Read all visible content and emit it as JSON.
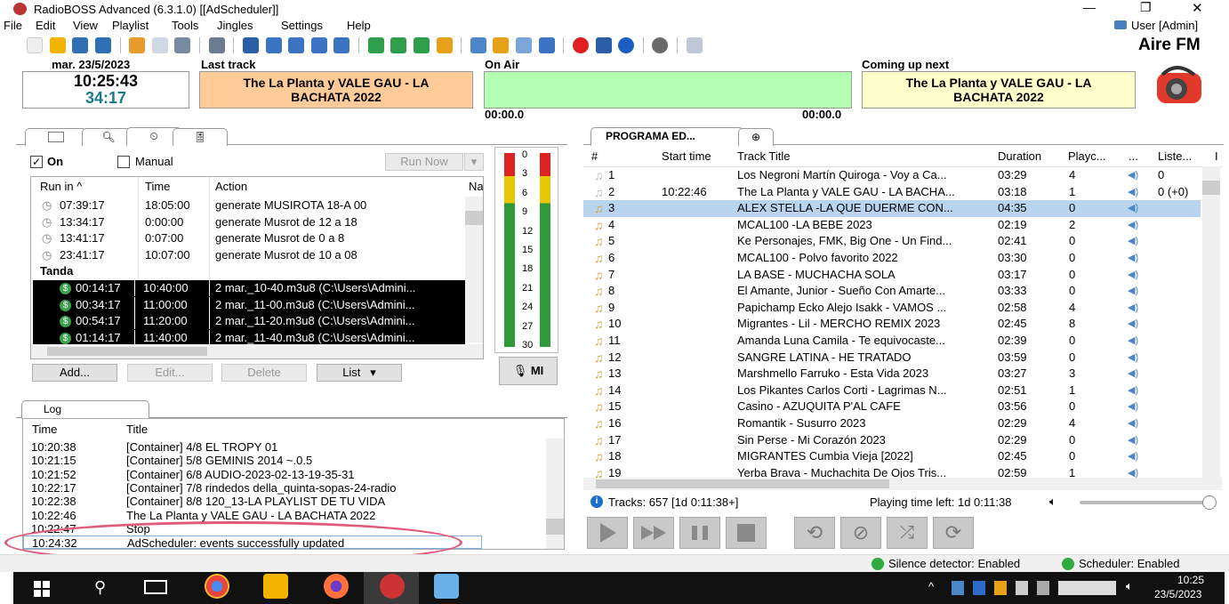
{
  "window": {
    "title": "RadioBOSS Advanced (6.3.1.0) [[AdScheduler]]",
    "user": "User [Admin]",
    "station": "Aire FM"
  },
  "menu": [
    "File",
    "Edit",
    "View",
    "Playlist",
    "Tools",
    "Jingles",
    "Settings",
    "Help"
  ],
  "info": {
    "date": "mar. 23/5/2023",
    "time": "10:25:43",
    "elapsed": "34:17",
    "last_track_label": "Last track",
    "last_track": "The La Planta y VALE GAU - LA BACHATA 2022",
    "on_air_label": "On Air",
    "on_air_start": "00:00.0",
    "on_air_end": "00:00.0",
    "next_label": "Coming up next",
    "next_track": "The La Planta y VALE GAU - LA BACHATA 2022"
  },
  "scheduler": {
    "on_label": "On",
    "manual_label": "Manual",
    "run_now": "Run Now",
    "columns": [
      "Run in",
      "Time",
      "Action",
      "Na"
    ],
    "rows": [
      {
        "runin": "07:39:17",
        "time": "18:05:00",
        "action": "generate MUSIROTA 18-A 00"
      },
      {
        "runin": "13:34:17",
        "time": "0:00:00",
        "action": "generate Musrot de 12 a 18"
      },
      {
        "runin": "13:41:17",
        "time": "0:07:00",
        "action": "generate Musrot de 0 a 8"
      },
      {
        "runin": "23:41:17",
        "time": "10:07:00",
        "action": "generate Musrot de 10 a 08"
      }
    ],
    "group": "Tanda",
    "tanda_rows": [
      {
        "runin": "00:14:17",
        "time": "10:40:00",
        "action": "2 mar._10-40.m3u8 (C:\\Users\\Admini..."
      },
      {
        "runin": "00:34:17",
        "time": "11:00:00",
        "action": "2 mar._11-00.m3u8 (C:\\Users\\Admini..."
      },
      {
        "runin": "00:54:17",
        "time": "11:20:00",
        "action": "2 mar._11-20.m3u8 (C:\\Users\\Admini..."
      },
      {
        "runin": "01:14:17",
        "time": "11:40:00",
        "action": "2 mar._11-40.m3u8 (C:\\Users\\Admini..."
      }
    ],
    "buttons": {
      "add": "Add...",
      "edit": "Edit...",
      "delete": "Delete",
      "list": "List"
    }
  },
  "meter": {
    "ticks": [
      "0",
      "3",
      "6",
      "9",
      "12",
      "15",
      "18",
      "21",
      "24",
      "27",
      "30"
    ],
    "mic_label": "MI"
  },
  "log": {
    "tab": "Log",
    "columns": [
      "Time",
      "Title"
    ],
    "rows": [
      {
        "time": "10:20:38",
        "title": "[Container] 4/8 EL TROPY 01"
      },
      {
        "time": "10:21:15",
        "title": "[Container] 5/8 GEMINIS 2014  ~.0.5"
      },
      {
        "time": "10:21:52",
        "title": "[Container] 6/8 AUDIO-2023-02-13-19-35-31"
      },
      {
        "time": "10:22:17",
        "title": "[Container] 7/8 rindedos  della_quinta-sopas-24-radio"
      },
      {
        "time": "10:22:38",
        "title": "[Container] 8/8 120_13-LA PLAYLIST DE TU VIDA"
      },
      {
        "time": "10:22:46",
        "title": "The La Planta y VALE GAU - LA BACHATA 2022"
      },
      {
        "time": "10:22:47",
        "title": "Stop"
      },
      {
        "time": "10:24:32",
        "title": "AdScheduler: events successfully updated"
      }
    ]
  },
  "playlist": {
    "tab": "PROGRAMA ED...",
    "columns": [
      "#",
      "Start time",
      "Track Title",
      "Duration",
      "Playc...",
      "...",
      "Liste...",
      "I"
    ],
    "rows": [
      {
        "n": "1",
        "start": "",
        "title": "Los Negroni Martín Quiroga - Voy a Ca...",
        "dur": "03:29",
        "plays": "4",
        "list": "0"
      },
      {
        "n": "2",
        "start": "10:22:46",
        "title": "The La Planta y VALE GAU - LA BACHA...",
        "dur": "03:18",
        "plays": "1",
        "list": "0 (+0)"
      },
      {
        "n": "3",
        "start": "",
        "title": "ALEX STELLA -LA QUE DUERME CON...",
        "dur": "04:35",
        "plays": "0",
        "list": ""
      },
      {
        "n": "4",
        "start": "",
        "title": "MCAL100 -LA BEBE 2023",
        "dur": "02:19",
        "plays": "2",
        "list": ""
      },
      {
        "n": "5",
        "start": "",
        "title": "Ke Personajes, FMK, Big One - Un Find...",
        "dur": "02:41",
        "plays": "0",
        "list": ""
      },
      {
        "n": "6",
        "start": "",
        "title": "MCAL100 - Polvo favorito 2022",
        "dur": "03:30",
        "plays": "0",
        "list": ""
      },
      {
        "n": "7",
        "start": "",
        "title": "LA BASE - MUCHACHA SOLA",
        "dur": "03:17",
        "plays": "0",
        "list": ""
      },
      {
        "n": "8",
        "start": "",
        "title": "El Amante, Junior - Sueño Con Amarte...",
        "dur": "03:33",
        "plays": "0",
        "list": ""
      },
      {
        "n": "9",
        "start": "",
        "title": "Papichamp Ecko Alejo Isakk - VAMOS ...",
        "dur": "02:58",
        "plays": "4",
        "list": ""
      },
      {
        "n": "10",
        "start": "",
        "title": "Migrantes - Lil - MERCHO REMIX 2023",
        "dur": "02:45",
        "plays": "8",
        "list": ""
      },
      {
        "n": "11",
        "start": "",
        "title": "Amanda Luna Camila - Te equivocaste...",
        "dur": "02:39",
        "plays": "0",
        "list": ""
      },
      {
        "n": "12",
        "start": "",
        "title": "SANGRE LATINA - HE TRATADO",
        "dur": "03:59",
        "plays": "0",
        "list": ""
      },
      {
        "n": "13",
        "start": "",
        "title": "Marshmello Farruko  - Esta Vida 2023",
        "dur": "03:27",
        "plays": "3",
        "list": ""
      },
      {
        "n": "14",
        "start": "",
        "title": "Los Pikantes Carlos Corti - Lagrimas N...",
        "dur": "02:51",
        "plays": "1",
        "list": ""
      },
      {
        "n": "15",
        "start": "",
        "title": "Casino - AZUQUITA P'AL CAFE",
        "dur": "03:56",
        "plays": "0",
        "list": ""
      },
      {
        "n": "16",
        "start": "",
        "title": "Romantik - Susurro 2023",
        "dur": "02:29",
        "plays": "4",
        "list": ""
      },
      {
        "n": "17",
        "start": "",
        "title": "Sin Perse - Mi Corazón 2023",
        "dur": "02:29",
        "plays": "0",
        "list": ""
      },
      {
        "n": "18",
        "start": "",
        "title": "MIGRANTES  Cumbia Vieja [2022]",
        "dur": "02:45",
        "plays": "0",
        "list": ""
      },
      {
        "n": "19",
        "start": "",
        "title": "Yerba Brava - Muchachita De Ojos Tris...",
        "dur": "02:59",
        "plays": "1",
        "list": ""
      }
    ],
    "selected_index": 2,
    "tracks_info": "Tracks: 657 [1d 0:11:38+]",
    "playing_left": "Playing time left: 1d 0:11:38"
  },
  "status": {
    "silence": "Silence detector: Enabled",
    "scheduler": "Scheduler: Enabled"
  },
  "taskbar": {
    "time": "10:25",
    "date": "23/5/2023"
  },
  "colors": {
    "last_track_bg": "#ffcc99",
    "on_air_bg": "#b3ffb3",
    "next_bg": "#ffffcc",
    "selected_row": "#b8d4ee",
    "tanda_bg": "#000000",
    "annotation": "#e05a7a"
  }
}
